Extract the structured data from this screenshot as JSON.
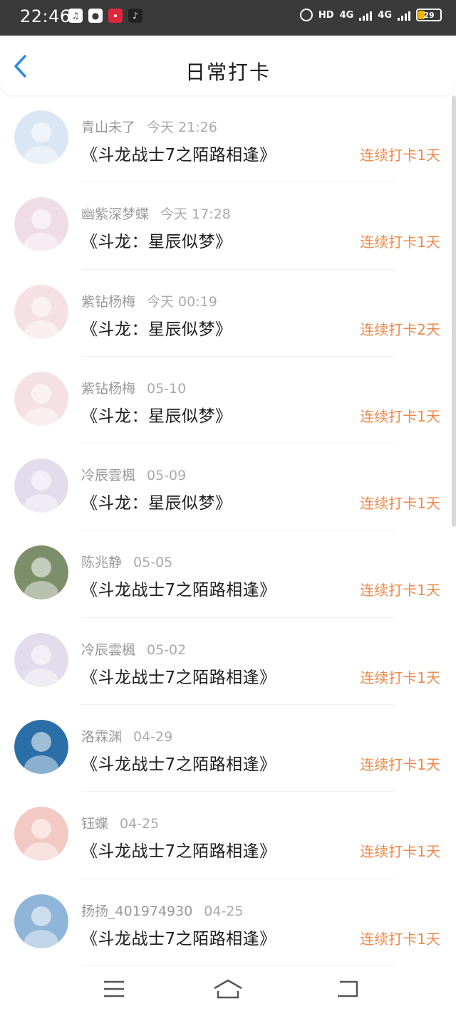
{
  "status_bar": {
    "time": "22:46",
    "hd": "HD",
    "net1": "4G",
    "net2": "4G",
    "battery": "29"
  },
  "header": {
    "title": "日常打卡"
  },
  "items": [
    {
      "name": "青山未了",
      "date": "今天  21:26",
      "book": "《斗龙战士7之陌路相逢》",
      "streak": "连续打卡1天",
      "avatar_color": "#dbe6f4"
    },
    {
      "name": "幽紫深梦蝶",
      "date": "今天  17:28",
      "book": "《斗龙：星辰似梦》",
      "streak": "连续打卡1天",
      "avatar_color": "#efdde6"
    },
    {
      "name": "紫钻杨梅",
      "date": "今天  00:19",
      "book": "《斗龙：星辰似梦》",
      "streak": "连续打卡2天",
      "avatar_color": "#f5e1e4"
    },
    {
      "name": "紫钻杨梅",
      "date": "05-10",
      "book": "《斗龙：星辰似梦》",
      "streak": "连续打卡1天",
      "avatar_color": "#f5e1e4"
    },
    {
      "name": "冷辰雲楓",
      "date": "05-09",
      "book": "《斗龙：星辰似梦》",
      "streak": "连续打卡1天",
      "avatar_color": "#e3dcec"
    },
    {
      "name": "陈兆静",
      "date": "05-05",
      "book": "《斗龙战士7之陌路相逢》",
      "streak": "连续打卡1天",
      "avatar_color": "#7d8f6a"
    },
    {
      "name": "冷辰雲楓",
      "date": "05-02",
      "book": "《斗龙战士7之陌路相逢》",
      "streak": "连续打卡1天",
      "avatar_color": "#e3dcec"
    },
    {
      "name": "洛霖渊",
      "date": "04-29",
      "book": "《斗龙战士7之陌路相逢》",
      "streak": "连续打卡1天",
      "avatar_color": "#2a6fa8"
    },
    {
      "name": "钰蝶",
      "date": "04-25",
      "book": "《斗龙战士7之陌路相逢》",
      "streak": "连续打卡1天",
      "avatar_color": "#f3c9c4"
    },
    {
      "name": "扬扬_401974930",
      "date": "04-25",
      "book": "《斗龙战士7之陌路相逢》",
      "streak": "连续打卡1天",
      "avatar_color": "#8fb6d8"
    }
  ],
  "icons": {
    "back": "chevron-left-icon",
    "menu": "menu-icon",
    "home": "home-icon",
    "return": "return-icon"
  },
  "colors": {
    "accent": "#2b8cf0",
    "streak": "#ef8a4a"
  }
}
